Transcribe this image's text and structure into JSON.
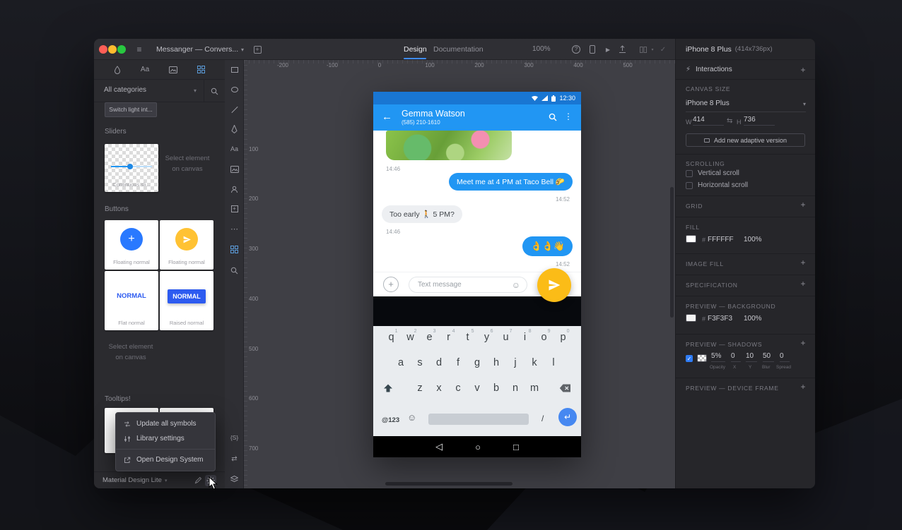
{
  "titlebar": {
    "title": "Messanger — Convers...",
    "tabs": [
      {
        "label": "Design"
      },
      {
        "label": "Documentation"
      }
    ],
    "zoom": "100%"
  },
  "library_panel": {
    "category_dropdown": "All categories",
    "clipped_item": "Switch light int...",
    "sliders": {
      "title": "Sliders",
      "item": "Continuous sli...",
      "hint": "Select element on canvas"
    },
    "buttons": {
      "title": "Buttons",
      "cards": [
        {
          "label": "Floating normal"
        },
        {
          "label": "Floating normal"
        },
        {
          "label": "Flat normal",
          "text": "NORMAL"
        },
        {
          "label": "Raised normal",
          "text": "NORMAL"
        }
      ],
      "hint": "Select element on canvas"
    },
    "tooltips": {
      "title": "Tooltips!"
    },
    "context_menu": {
      "items": [
        {
          "label": "Update all symbols"
        },
        {
          "label": "Library settings"
        },
        {
          "label": "Open Design System"
        }
      ]
    },
    "footer": {
      "library": "Material Design Lite"
    }
  },
  "toolstrip": {
    "code_icon_label": "{S}"
  },
  "canvas": {
    "h_ruler": [
      "-200",
      "-100",
      "0",
      "100",
      "200",
      "300",
      "400",
      "500"
    ],
    "v_ruler": [
      "100",
      "200",
      "300",
      "400",
      "500",
      "600",
      "700"
    ]
  },
  "artboard": {
    "status": {
      "time": "12:30"
    },
    "header": {
      "name": "Gemma Watson",
      "phone": "(585) 210-1610"
    },
    "chat": {
      "time1": "14:46",
      "sent1": {
        "text": "Meet me at 4 PM at Taco Bell 🌮",
        "time": "14:52"
      },
      "received": {
        "text": "Too early 🚶 5 PM?",
        "time": "14:46"
      },
      "sent2": {
        "text": "👌👌👋",
        "time": "14:52"
      }
    },
    "composer": {
      "placeholder": "Text message"
    },
    "keyboard": {
      "row1": [
        "q",
        "w",
        "e",
        "r",
        "t",
        "y",
        "u",
        "i",
        "o",
        "p"
      ],
      "row1_sup": [
        "1",
        "2",
        "3",
        "4",
        "5",
        "6",
        "7",
        "8",
        "9",
        "0"
      ],
      "row2": [
        "a",
        "s",
        "d",
        "f",
        "g",
        "h",
        "j",
        "k",
        "l"
      ],
      "row3": [
        "z",
        "x",
        "c",
        "v",
        "b",
        "n",
        "m"
      ],
      "symbols_key": "@123",
      "slash": "/"
    }
  },
  "inspector": {
    "artboard_name": "iPhone 8 Plus",
    "artboard_size": "(414x736px)",
    "interactions": {
      "label": "Interactions"
    },
    "canvas_size": {
      "label": "CANVAS SIZE",
      "preset": "iPhone 8 Plus",
      "w_label": "W",
      "w": "414",
      "h_label": "H",
      "h": "736",
      "add_button": "Add new adaptive version"
    },
    "scrolling": {
      "label": "SCROLLING",
      "vertical": "Vertical scroll",
      "horizontal": "Horizontal scroll"
    },
    "grid": {
      "label": "GRID"
    },
    "fill": {
      "label": "FILL",
      "hash": "#",
      "hex": "FFFFFF",
      "opacity": "100%"
    },
    "image_fill": {
      "label": "IMAGE FILL"
    },
    "specification": {
      "label": "SPECIFICATION"
    },
    "preview_background": {
      "label": "PREVIEW — BACKGROUND",
      "hash": "#",
      "hex": "F3F3F3",
      "opacity": "100%"
    },
    "preview_shadows": {
      "label": "PREVIEW — SHADOWS",
      "opacity": "5%",
      "x": "0",
      "y": "10",
      "blur": "50",
      "spread": "0",
      "col_labels": [
        "Opacity",
        "X",
        "Y",
        "Blur",
        "Spread"
      ]
    },
    "preview_device_frame": {
      "label": "PREVIEW — DEVICE FRAME"
    }
  },
  "colors": {
    "material_blue": "#2196F3",
    "status_blue": "#1976D2",
    "send_yellow": "#FBBC17",
    "raised_button_blue": "#2D5BF0",
    "active_tab_blue": "#3F8CFF",
    "checkbox_blue": "#2F7CF6"
  }
}
